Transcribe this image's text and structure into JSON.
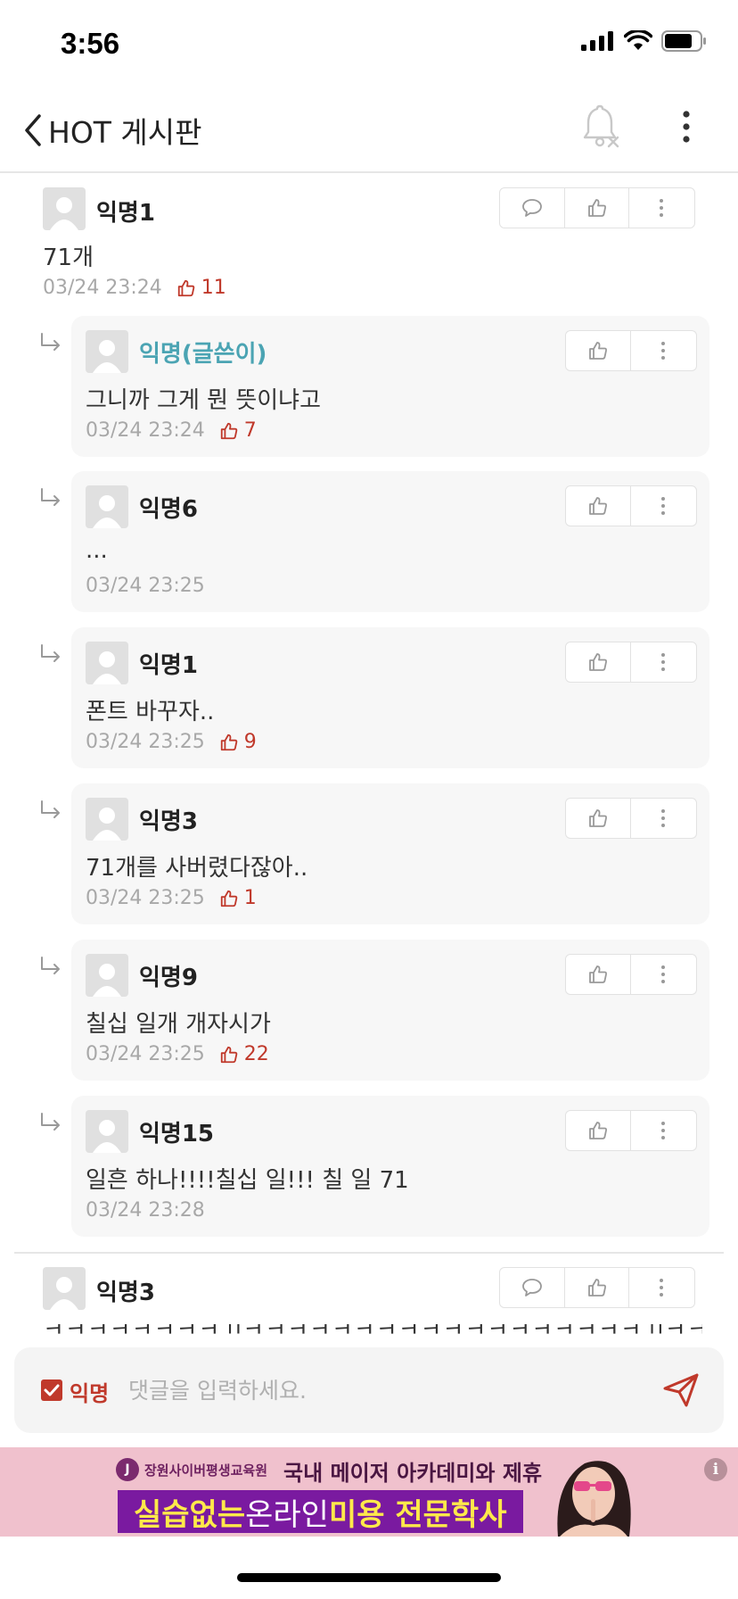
{
  "status": {
    "time": "3:56"
  },
  "nav": {
    "title": "HOT 게시판"
  },
  "comments": [
    {
      "author": "익명1",
      "text": "71개",
      "time": "03/24 23:24",
      "likes": "11"
    },
    {
      "author": "익명3",
      "text": "ㅋㅋㅋㅋㅋㅋㅋㅋㄲㅋㅋㅋㅋㅋㅋㅋㅋㅋㅋㅋㅋㅋㅋㅋㅋㅋㅋㄲㅋㅋㅋㅋ"
    }
  ],
  "replies": [
    {
      "author": "익명(글쓴이)",
      "text": "그니까 그게 뭔 뜻이냐고",
      "time": "03/24 23:24",
      "likes": "7"
    },
    {
      "author": "익명6",
      "text": "...",
      "time": "03/24 23:25",
      "likes": ""
    },
    {
      "author": "익명1",
      "text": "폰트 바꾸자..",
      "time": "03/24 23:25",
      "likes": "9"
    },
    {
      "author": "익명3",
      "text": "71개를 사버렸다잖아..",
      "time": "03/24 23:25",
      "likes": "1"
    },
    {
      "author": "익명9",
      "text": "칠십 일개 개자시가",
      "time": "03/24 23:25",
      "likes": "22"
    },
    {
      "author": "익명15",
      "text": "일흔 하나!!!!칠십 일!!! 칠 일 71",
      "time": "03/24 23:28",
      "likes": ""
    }
  ],
  "input": {
    "anon_label": "익명",
    "placeholder": "댓글을 입력하세요."
  },
  "ad": {
    "org": "장원사이버평생교육원",
    "headline": "국내 메이저 아카데미와 제휴",
    "main_1": "실습없는",
    "main_2": " 온라인 ",
    "main_3": "미용 전문학사",
    "info": "i"
  },
  "colors": {
    "accent": "#c0392b",
    "op_author": "#4ba4b3",
    "reply_bg": "#f7f7f7"
  }
}
